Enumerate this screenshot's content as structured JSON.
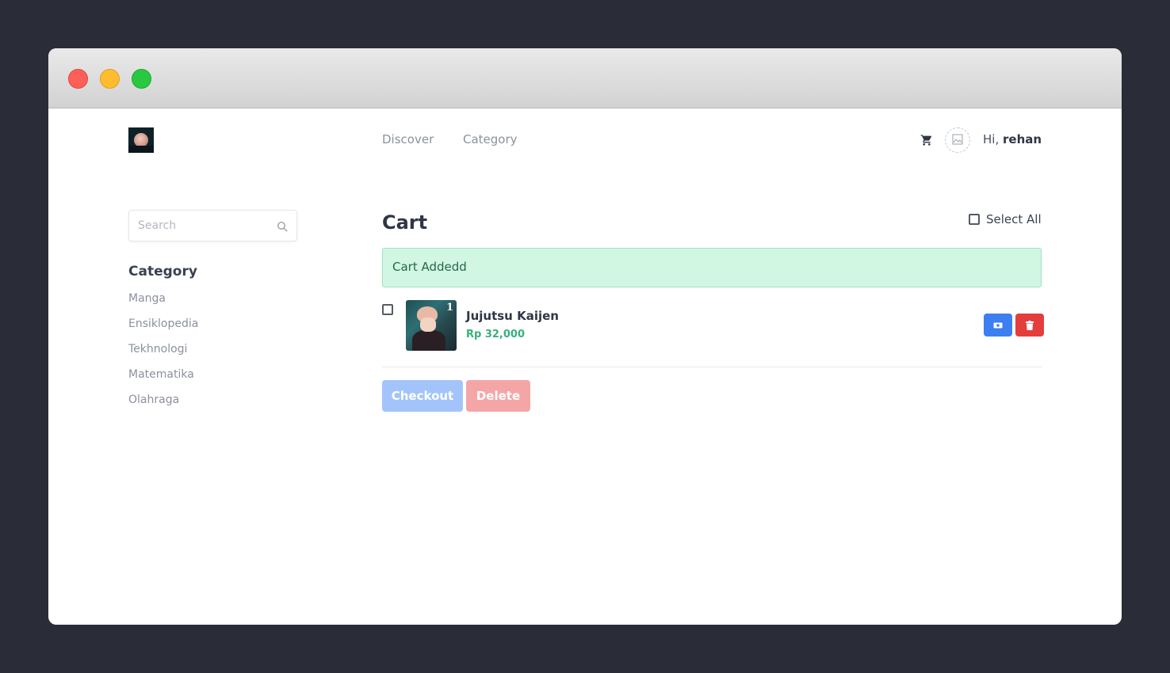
{
  "nav": {
    "links": [
      "Discover",
      "Category"
    ],
    "greeting_prefix": "Hi,",
    "username": "rehan"
  },
  "sidebar": {
    "search_placeholder": "Search",
    "title": "Category",
    "items": [
      "Manga",
      "Ensiklopedia",
      "Tekhnologi",
      "Matematika",
      "Olahraga"
    ]
  },
  "cart": {
    "title": "Cart",
    "select_all_label": "Select All",
    "alert": "Cart Addedd",
    "items": [
      {
        "name": "Jujutsu Kaijen",
        "price": "Rp 32,000",
        "cover_number": "1"
      }
    ],
    "checkout_label": "Checkout",
    "delete_label": "Delete"
  },
  "colors": {
    "primary": "#3d7ff0",
    "danger": "#e43d3d",
    "success_text": "#38b07a",
    "alert_bg": "#d1f7e3"
  },
  "icons": {
    "cart": "shopping-cart-icon",
    "search": "search-icon",
    "pay": "money-icon",
    "trash": "trash-icon"
  }
}
